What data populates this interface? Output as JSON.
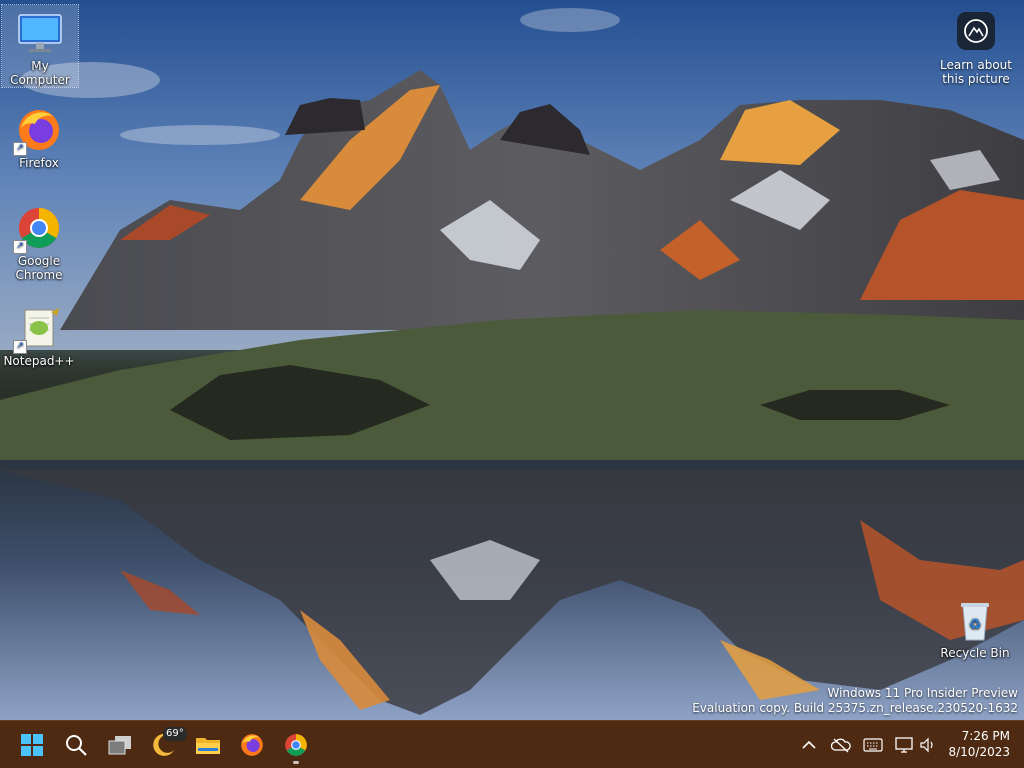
{
  "desktop_icons": {
    "my_computer": "My Computer",
    "firefox": "Firefox",
    "chrome": "Google Chrome",
    "notepadpp": "Notepad++",
    "recycle_bin": "Recycle Bin"
  },
  "learn_picture": "Learn about this picture",
  "watermark": {
    "line1": "Windows 11 Pro Insider Preview",
    "line2": "Evaluation copy. Build 25375.zn_release.230520-1632"
  },
  "taskbar": {
    "weather_temp": "69°",
    "time": "7:26 PM",
    "date": "8/10/2023",
    "pinned": [
      "start-icon",
      "search-icon",
      "task-view-icon",
      "weather-icon",
      "file-explorer-icon",
      "firefox-icon",
      "chrome-icon"
    ],
    "tray": [
      "chevron-up-icon",
      "cloud-offline-icon",
      "keyboard-icon",
      "network-icon",
      "speaker-icon"
    ]
  },
  "colors": {
    "taskbar": "#4e2a12",
    "accent": "#1a75d6"
  }
}
